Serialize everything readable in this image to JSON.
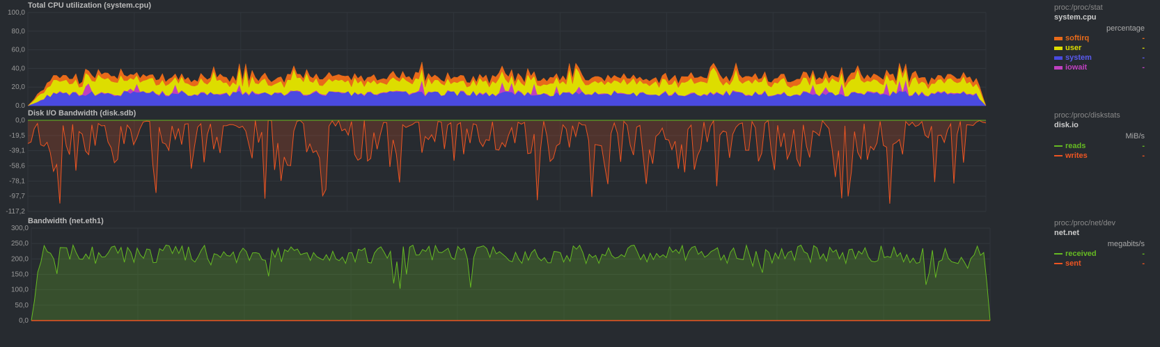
{
  "chart_data": [
    {
      "type": "area",
      "title": "Total CPU utilization (system.cpu)",
      "source": "proc:/proc/stat",
      "context": "system.cpu",
      "units": "percentage",
      "ylim": [
        0,
        100
      ],
      "y_ticks": [
        "100,0",
        "80,0",
        "60,0",
        "40,0",
        "20,0",
        "0,0"
      ],
      "stacked": true,
      "series": [
        {
          "name": "softirq",
          "color": "#e86a1a",
          "value_text": "-",
          "mean": 5,
          "amp": 2
        },
        {
          "name": "user",
          "color": "#dddd00",
          "value_text": "-",
          "mean": 12,
          "amp": 4
        },
        {
          "name": "system",
          "color": "#4a4ae0",
          "value_text": "-",
          "mean": 13,
          "amp": 3
        },
        {
          "name": "iowait",
          "color": "#c040c0",
          "value_text": "-",
          "mean": 1,
          "amp": 2
        }
      ]
    },
    {
      "type": "area",
      "title": "Disk I/O Bandwidth (disk.sdb)",
      "source": "proc:/proc/diskstats",
      "context": "disk.io",
      "units": "MiB/s",
      "ylim": [
        -117.2,
        0
      ],
      "y_ticks": [
        "0,0",
        "-19,5",
        "-39,1",
        "-58,6",
        "-78,1",
        "-97,7",
        "-117,2"
      ],
      "series": [
        {
          "name": "reads",
          "color": "#66bb22",
          "value_text": "-"
        },
        {
          "name": "writes",
          "color": "#ee5522",
          "value_text": "-",
          "mean": -25,
          "amp": 50
        }
      ]
    },
    {
      "type": "area",
      "title": "Bandwidth (net.eth1)",
      "source": "proc:/proc/net/dev",
      "context": "net.net",
      "units": "megabits/s",
      "ylim": [
        0,
        300
      ],
      "y_ticks": [
        "300,0",
        "250,0",
        "200,0",
        "150,0",
        "100,0",
        "50,0",
        "0,0"
      ],
      "series": [
        {
          "name": "received",
          "color": "#66bb22",
          "value_text": "-",
          "mean": 215,
          "amp": 30
        },
        {
          "name": "sent",
          "color": "#ee5522",
          "value_text": "-",
          "mean": 0,
          "amp": 0
        }
      ]
    }
  ]
}
